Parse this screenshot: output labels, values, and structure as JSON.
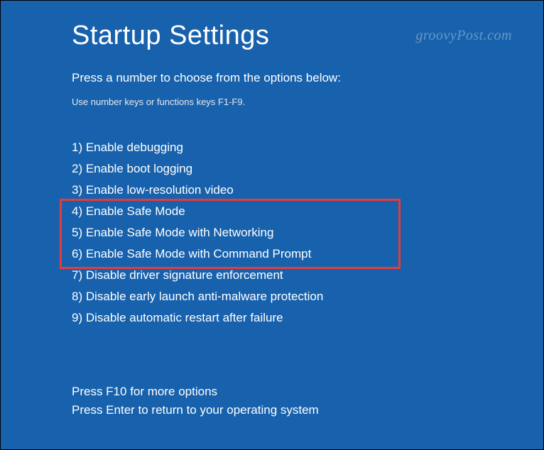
{
  "title": "Startup Settings",
  "subtitle": "Press a number to choose from the options below:",
  "hint": "Use number keys or functions keys F1-F9.",
  "options": [
    "1) Enable debugging",
    "2) Enable boot logging",
    "3) Enable low-resolution video",
    "4) Enable Safe Mode",
    "5) Enable Safe Mode with Networking",
    "6) Enable Safe Mode with Command Prompt",
    "7) Disable driver signature enforcement",
    "8) Disable early launch anti-malware protection",
    "9) Disable automatic restart after failure"
  ],
  "footer": {
    "more": "Press F10 for more options",
    "return": "Press Enter to return to your operating system"
  },
  "watermark": "groovyPost.com"
}
